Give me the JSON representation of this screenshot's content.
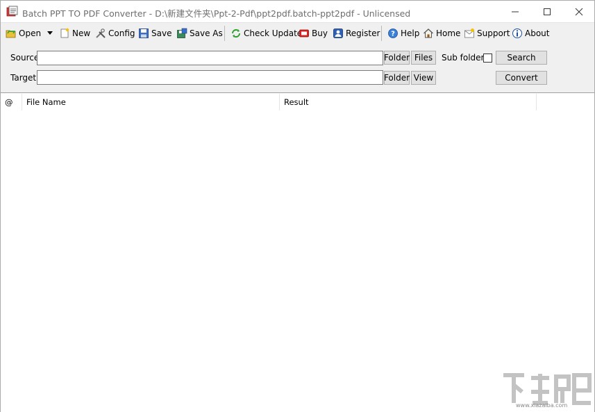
{
  "window": {
    "title": "Batch PPT TO PDF Converter - D:\\新建文件夹\\Ppt-2-Pdf\\ppt2pdf.batch-ppt2pdf - Unlicensed",
    "controls": {
      "minimize": "—",
      "maximize": "☐",
      "close": "✕"
    }
  },
  "toolbar": {
    "open": "Open",
    "new": "New",
    "config": "Config",
    "save": "Save",
    "save_as": "Save As",
    "check_update": "Check Update",
    "buy": "Buy",
    "register": "Register",
    "help": "Help",
    "home": "Home",
    "support": "Support",
    "about": "About"
  },
  "form": {
    "source_label": "Source",
    "target_label": "Target",
    "source_value": "",
    "target_value": "",
    "source_folder_btn": "Folder",
    "files_btn": "Files",
    "subfolders_label": "Sub folders",
    "subfolders_checked": false,
    "search_btn": "Search",
    "target_folder_btn": "Folder",
    "view_btn": "View",
    "convert_btn": "Convert"
  },
  "list": {
    "columns": [
      "@",
      "File Name",
      "Result"
    ],
    "rows": []
  },
  "watermark": {
    "url": "www.xiazaiba.com"
  },
  "colors": {
    "toolbar_bg": "#f0f0f0",
    "title_text": "#6e6e6e"
  }
}
